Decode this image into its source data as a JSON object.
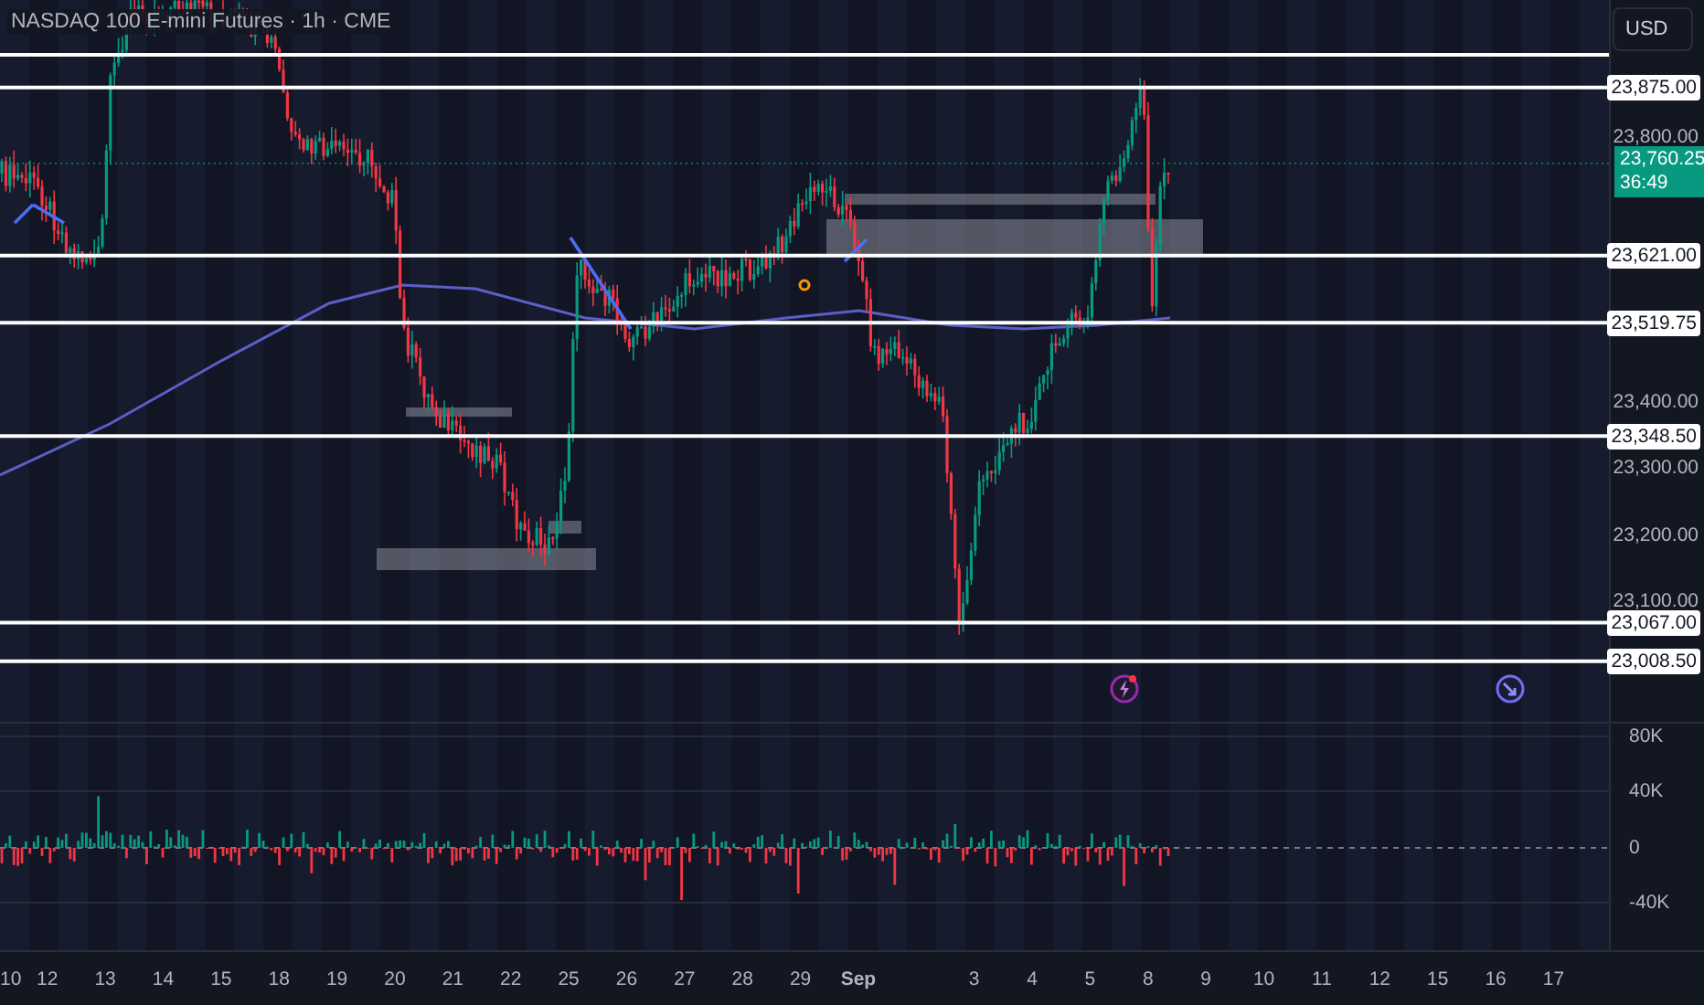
{
  "chart": {
    "title": "NASDAQ 100 E-mini Futures · 1h · CME"
  },
  "currency_button": {
    "label": "USD"
  },
  "price_scale": {
    "labels": [
      "23,800.00",
      "23,400.00",
      "23,300.00",
      "23,200.00",
      "23,100.00"
    ]
  },
  "levels": [
    {
      "price": "23,875.00"
    },
    {
      "price": "23,621.00"
    },
    {
      "price": "23,519.75"
    },
    {
      "price": "23,348.50"
    },
    {
      "price": "23,067.00"
    },
    {
      "price": "23,008.50"
    }
  ],
  "current_price": {
    "price": "23,760.25",
    "countdown": "36:49"
  },
  "indicator_scale": {
    "labels": [
      "80K",
      "40K",
      "0",
      "-40K"
    ]
  },
  "time_axis": {
    "labels": [
      {
        "text": "10",
        "kind": "day"
      },
      {
        "text": "12",
        "kind": "day"
      },
      {
        "text": "13",
        "kind": "day"
      },
      {
        "text": "14",
        "kind": "day"
      },
      {
        "text": "15",
        "kind": "day"
      },
      {
        "text": "18",
        "kind": "day"
      },
      {
        "text": "19",
        "kind": "day"
      },
      {
        "text": "20",
        "kind": "day"
      },
      {
        "text": "21",
        "kind": "day"
      },
      {
        "text": "22",
        "kind": "day"
      },
      {
        "text": "25",
        "kind": "day"
      },
      {
        "text": "26",
        "kind": "day"
      },
      {
        "text": "27",
        "kind": "day"
      },
      {
        "text": "28",
        "kind": "day"
      },
      {
        "text": "29",
        "kind": "day"
      },
      {
        "text": "Sep",
        "kind": "month"
      },
      {
        "text": "3",
        "kind": "day"
      },
      {
        "text": "4",
        "kind": "day"
      },
      {
        "text": "5",
        "kind": "day"
      },
      {
        "text": "8",
        "kind": "day"
      },
      {
        "text": "9",
        "kind": "day"
      },
      {
        "text": "10",
        "kind": "day"
      },
      {
        "text": "11",
        "kind": "day"
      },
      {
        "text": "12",
        "kind": "day"
      },
      {
        "text": "15",
        "kind": "day"
      },
      {
        "text": "16",
        "kind": "day"
      },
      {
        "text": "17",
        "kind": "day"
      }
    ]
  }
}
